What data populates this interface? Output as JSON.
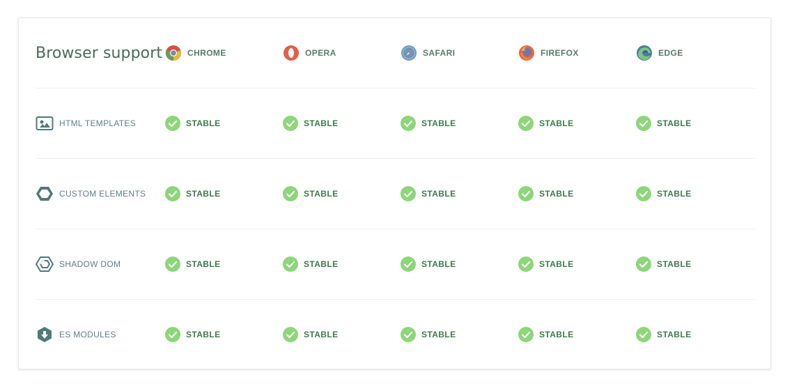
{
  "title": "Browser support",
  "browsers": [
    {
      "name": "CHROME",
      "icon": "chrome-icon"
    },
    {
      "name": "OPERA",
      "icon": "opera-icon"
    },
    {
      "name": "SAFARI",
      "icon": "safari-icon"
    },
    {
      "name": "FIREFOX",
      "icon": "firefox-icon"
    },
    {
      "name": "EDGE",
      "icon": "edge-icon"
    }
  ],
  "features": [
    {
      "label": "HTML TEMPLATES",
      "icon": "image-template-icon",
      "statuses": [
        "STABLE",
        "STABLE",
        "STABLE",
        "STABLE",
        "STABLE"
      ]
    },
    {
      "label": "CUSTOM ELEMENTS",
      "icon": "hexagon-icon",
      "statuses": [
        "STABLE",
        "STABLE",
        "STABLE",
        "STABLE",
        "STABLE"
      ]
    },
    {
      "label": "SHADOW DOM",
      "icon": "shadow-dom-icon",
      "statuses": [
        "STABLE",
        "STABLE",
        "STABLE",
        "STABLE",
        "STABLE"
      ]
    },
    {
      "label": "ES MODULES",
      "icon": "es-modules-icon",
      "statuses": [
        "STABLE",
        "STABLE",
        "STABLE",
        "STABLE",
        "STABLE"
      ]
    }
  ],
  "colors": {
    "stable_check": "#8dd67a",
    "stable_text": "#3f7a4c",
    "feature_text": "#5f7f8a",
    "title_text": "#4a6b57",
    "icon_teal": "#4f7a78"
  }
}
